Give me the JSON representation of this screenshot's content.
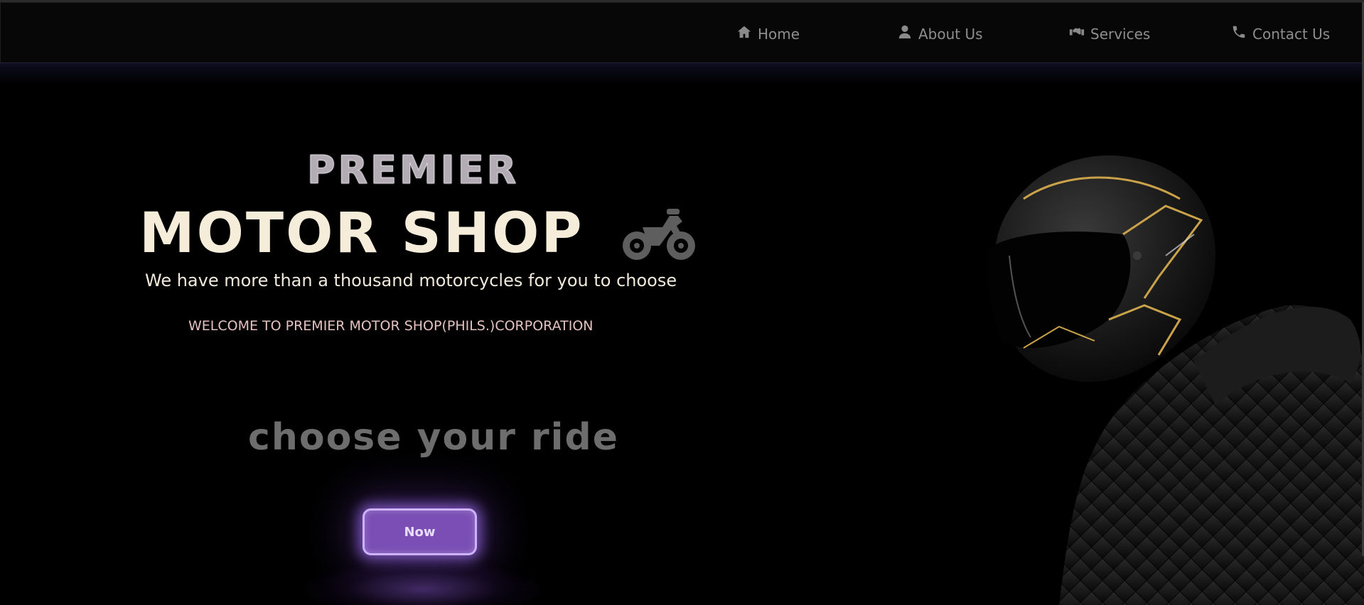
{
  "nav": {
    "items": [
      {
        "label": "Home",
        "icon": "home-icon"
      },
      {
        "label": "About Us",
        "icon": "user-icon"
      },
      {
        "label": "Services",
        "icon": "handshake-icon"
      },
      {
        "label": "Contact Us",
        "icon": "phone-icon"
      }
    ]
  },
  "hero": {
    "premier": "PREMIER",
    "motor_shop": "MOTOR SHOP",
    "bike_icon": "motorcycle-icon",
    "tagline": "We have more than a thousand motorcycles for you to choose",
    "welcome": "WELCOME TO PREMIER MOTOR SHOP(PHILS.)CORPORATION",
    "choose": "choose your ride",
    "button_label": "Now"
  },
  "colors": {
    "background": "#000000",
    "nav_text": "#8e8e8e",
    "title": "#f6ecda",
    "button_fill": "#7a4eb5",
    "button_border": "#cdb2ff",
    "helmet_accent": "#c9a24a"
  }
}
